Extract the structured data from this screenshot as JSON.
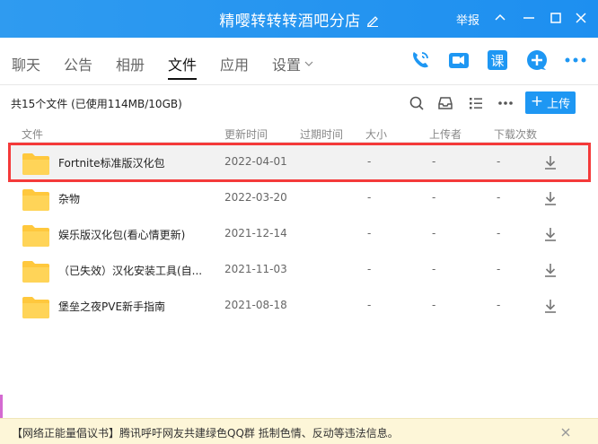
{
  "window": {
    "title": "精嘤转转转酒吧分店",
    "report_label": "举报"
  },
  "nav": {
    "tabs": [
      {
        "label": "聊天"
      },
      {
        "label": "公告"
      },
      {
        "label": "相册"
      },
      {
        "label": "文件"
      },
      {
        "label": "应用"
      },
      {
        "label": "设置"
      }
    ],
    "active_tab": "文件",
    "right_icons": [
      "phone-icon",
      "video-icon",
      "class-icon",
      "add-icon",
      "more-icon"
    ]
  },
  "files": {
    "summary": "共15个文件 (已使用114MB/10GB)",
    "upload_label": "上传",
    "columns": [
      "文件",
      "更新时间",
      "过期时间",
      "大小",
      "上传者",
      "下载次数"
    ],
    "rows": [
      {
        "name": "Fortnite标准版汉化包",
        "updated": "2022-04-01",
        "size": "-",
        "uploader": "-",
        "downloads": "-",
        "selected": true
      },
      {
        "name": "杂物",
        "updated": "2022-03-20",
        "size": "-",
        "uploader": "-",
        "downloads": "-",
        "selected": false
      },
      {
        "name": "娱乐版汉化包(看心情更新)",
        "updated": "2021-12-14",
        "size": "-",
        "uploader": "-",
        "downloads": "-",
        "selected": false
      },
      {
        "name": "（已失效）汉化安装工具(自...",
        "updated": "2021-11-03",
        "size": "-",
        "uploader": "-",
        "downloads": "-",
        "selected": false
      },
      {
        "name": "堡垒之夜PVE新手指南",
        "updated": "2021-08-18",
        "size": "-",
        "uploader": "-",
        "downloads": "-",
        "selected": false
      }
    ]
  },
  "notice": {
    "text": "【网络正能量倡议书】腾讯呼吁网友共建绿色QQ群 抵制色情、反动等违法信息。"
  },
  "colors": {
    "titlebar": "#1d8ff0",
    "accent": "#1e97f3",
    "folder": "#ffc83d",
    "highlight": "#f43a3a"
  }
}
